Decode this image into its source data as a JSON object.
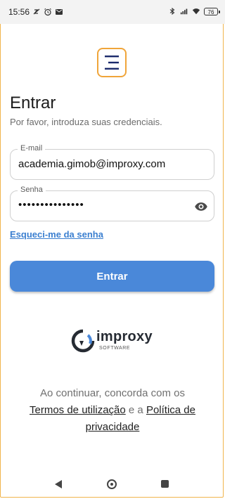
{
  "status_bar": {
    "time": "15:56",
    "battery": "76"
  },
  "login": {
    "title": "Entrar",
    "subtitle": "Por favor, introduza suas credenciais.",
    "email_label": "E-mail",
    "email_value": "academia.gimob@improxy.com",
    "password_label": "Senha",
    "password_value": "•••••••••••••••",
    "forgot_password": "Esqueci-me da senha",
    "submit": "Entrar"
  },
  "brand": {
    "name": "improxy",
    "tagline": "SOFTWARE"
  },
  "terms": {
    "intro": "Ao continuar, concorda com os",
    "terms_link": "Termos de utilização",
    "conjunction": "e a",
    "privacy_link_1": "Política de",
    "privacy_link_2": "privacidade"
  },
  "colors": {
    "primary": "#4a88d9",
    "link": "#3b7fd0",
    "logo_border": "#f0a53a",
    "logo_mark": "#1b2a6b"
  },
  "icons": {
    "status_left": [
      "do-not-disturb-icon",
      "alarm-icon",
      "message-icon"
    ],
    "status_right": [
      "bluetooth-icon",
      "signal-icon",
      "wifi-icon",
      "battery-icon"
    ],
    "password_toggle": "eye-icon"
  }
}
